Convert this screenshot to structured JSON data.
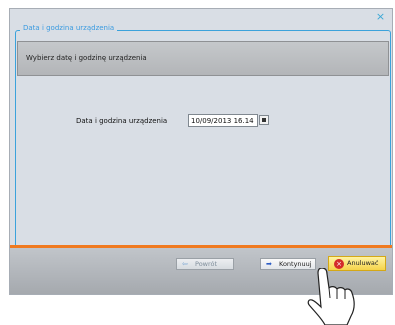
{
  "window": {
    "close_glyph": "×"
  },
  "group": {
    "legend": "Data i godzina urządzenia"
  },
  "instruction": {
    "text": "Wybierz datę i godzinę urządzenia"
  },
  "datetime_field": {
    "label": "Data i godzina urządzenia",
    "value": "10/09/2013 16.14"
  },
  "footer": {
    "back_label": "Powrót",
    "continue_label": "Kontynuuj",
    "cancel_label": "Anuluwać"
  },
  "icons": {
    "close": "close-icon",
    "calendar": "calendar-icon",
    "back": "back-arrow-icon",
    "continue": "forward-arrow-icon",
    "cancel": "cancel-x-icon",
    "hand": "pointing-hand-icon"
  },
  "colors": {
    "accent": "#3ba2db",
    "separator": "#f07a20",
    "cancel_button": "#f5d34a"
  }
}
